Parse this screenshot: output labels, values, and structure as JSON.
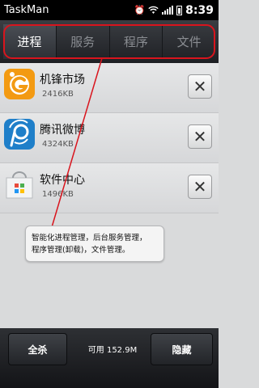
{
  "statusbar": {
    "app_title": "TaskMan",
    "time": "8:39",
    "icons": [
      "alarm-icon",
      "wifi-icon",
      "signal-icon",
      "battery-icon"
    ]
  },
  "tabs": [
    {
      "label": "进程",
      "active": true
    },
    {
      "label": "服务",
      "active": false
    },
    {
      "label": "程序",
      "active": false
    },
    {
      "label": "文件",
      "active": false
    }
  ],
  "processes": [
    {
      "name": "机锋市场",
      "size": "2416KB",
      "icon": "gfan-market-icon",
      "color": "#f39a12"
    },
    {
      "name": "腾讯微博",
      "size": "4324KB",
      "icon": "tencent-weibo-icon",
      "color": "#1f7fc9"
    },
    {
      "name": "软件中心",
      "size": "1496KB",
      "icon": "software-center-icon",
      "color": "#e9ecef"
    }
  ],
  "kill_symbol": "✕",
  "annotation": {
    "line1": "智能化进程管理，后台服务管理，",
    "line2": "程序管理(卸载)，文件管理。",
    "color": "#d9141d"
  },
  "bottombar": {
    "kill_all_label": "全杀",
    "available": "可用 152.9M",
    "hide_label": "隐藏"
  }
}
